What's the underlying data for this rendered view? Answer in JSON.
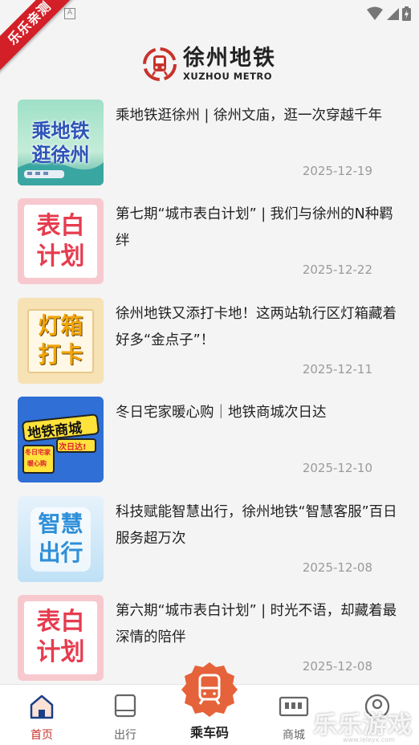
{
  "status": {
    "carrier_icon": "A",
    "icons": [
      "wifi-icon",
      "signal-icon",
      "battery-icon"
    ]
  },
  "ribbon": {
    "text": "乐乐亲测"
  },
  "header": {
    "logo_cn": "徐州地铁",
    "logo_en": "XUZHOU METRO"
  },
  "news": [
    {
      "title": "乘地铁逛徐州 | 徐州文庙，逛一次穿越千年",
      "date": "2025-12-19",
      "thumb_lines": [
        "乘地铁",
        "逛徐州"
      ]
    },
    {
      "title": "第七期“城市表白计划” | 我们与徐州的N种羁绊",
      "date": "2025-12-22",
      "thumb_lines": [
        "表白",
        "计划"
      ]
    },
    {
      "title": "徐州地铁又添打卡地！这两站轨行区灯箱藏着好多“金点子”！",
      "date": "2025-12-11",
      "thumb_lines": [
        "灯箱",
        "打卡"
      ]
    },
    {
      "title": "冬日宅家暖心购｜地铁商城次日达",
      "date": "2025-12-10",
      "thumb_lines": [
        "地铁商城",
        "次日达!",
        "冬日宅家",
        "暖心购"
      ]
    },
    {
      "title": "科技赋能智慧出行，徐州地铁“智慧客服”百日服务超万次",
      "date": "2025-12-08",
      "thumb_lines": [
        "智慧",
        "出行"
      ]
    },
    {
      "title": "第六期“城市表白计划” | 时光不语，却藏着最深情的陪伴",
      "date": "2025-12-08",
      "thumb_lines": [
        "表白",
        "计划"
      ]
    }
  ],
  "tabs": {
    "home": "首页",
    "travel": "出行",
    "ride_code": "乘车码",
    "mall": "商城",
    "mine": ""
  },
  "watermark": {
    "text": "乐乐游戏",
    "url": "www.leleyx.com"
  },
  "colors": {
    "accent": "#c8322b",
    "tab_active": "#c8322b",
    "badge": "#e5623a"
  }
}
